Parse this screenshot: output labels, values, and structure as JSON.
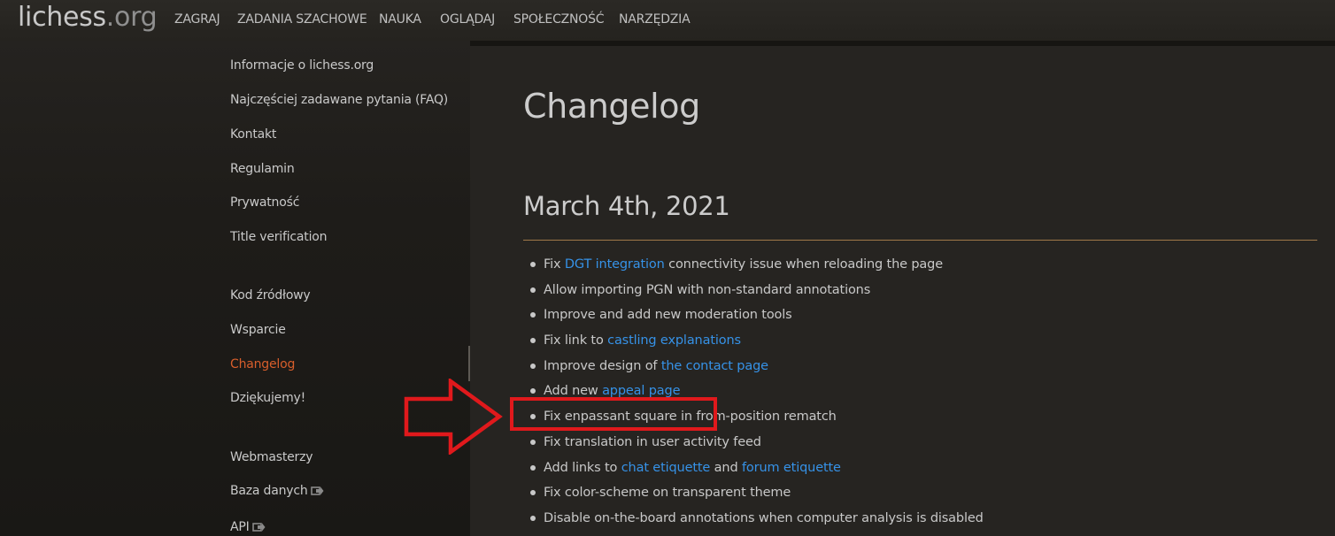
{
  "header": {
    "logo_main": "lichess",
    "logo_tld": ".org",
    "nav": [
      "ZAGRAJ",
      "ZADANIA SZACHOWE",
      "NAUKA",
      "OGLĄDAJ",
      "SPOŁECZNOŚĆ",
      "NARZĘDZIA"
    ]
  },
  "sidebar": {
    "items": [
      "Informacje o lichess.org",
      "Najczęściej zadawane pytania (FAQ)",
      "Kontakt",
      "Regulamin",
      "Prywatność",
      "Title verification",
      "Kod źródłowy",
      "Wsparcie",
      "Changelog",
      "Dziękujemy!",
      "Webmasterzy",
      "Baza danych",
      "API"
    ],
    "active_item": "Changelog",
    "external_icon": "external-link-icon"
  },
  "main": {
    "title": "Changelog",
    "section_date": "March 4th, 2021",
    "entries": [
      {
        "pre": "Fix ",
        "link": "DGT integration",
        "post": " connectivity issue when reloading the page"
      },
      {
        "pre": "Allow importing PGN with non-standard annotations",
        "link": "",
        "post": ""
      },
      {
        "pre": "Improve and add new moderation tools",
        "link": "",
        "post": ""
      },
      {
        "pre": "Fix link to ",
        "link": "castling explanations",
        "post": ""
      },
      {
        "pre": "Improve design of ",
        "link": "the contact page",
        "post": ""
      },
      {
        "pre": "Add new ",
        "link": "appeal page",
        "post": ""
      },
      {
        "pre": "Fix enpassant square in from-position rematch",
        "link": "",
        "post": ""
      },
      {
        "pre": "Fix translation in user activity feed",
        "link": "",
        "post": ""
      },
      {
        "pre": "Add links to ",
        "link": "chat etiquette",
        "post": " and ",
        "link2": "forum etiquette"
      },
      {
        "pre": "Fix color-scheme on transparent theme",
        "link": "",
        "post": ""
      },
      {
        "pre": "Disable on-the-board annotations when computer analysis is disabled",
        "link": "",
        "post": ""
      }
    ]
  },
  "annotation": {
    "arrow_icon": "right-arrow-outline-icon",
    "color": "#e0191c"
  },
  "colors": {
    "link": "#3692e7",
    "active": "#d85e2b",
    "rule": "#a07848"
  }
}
